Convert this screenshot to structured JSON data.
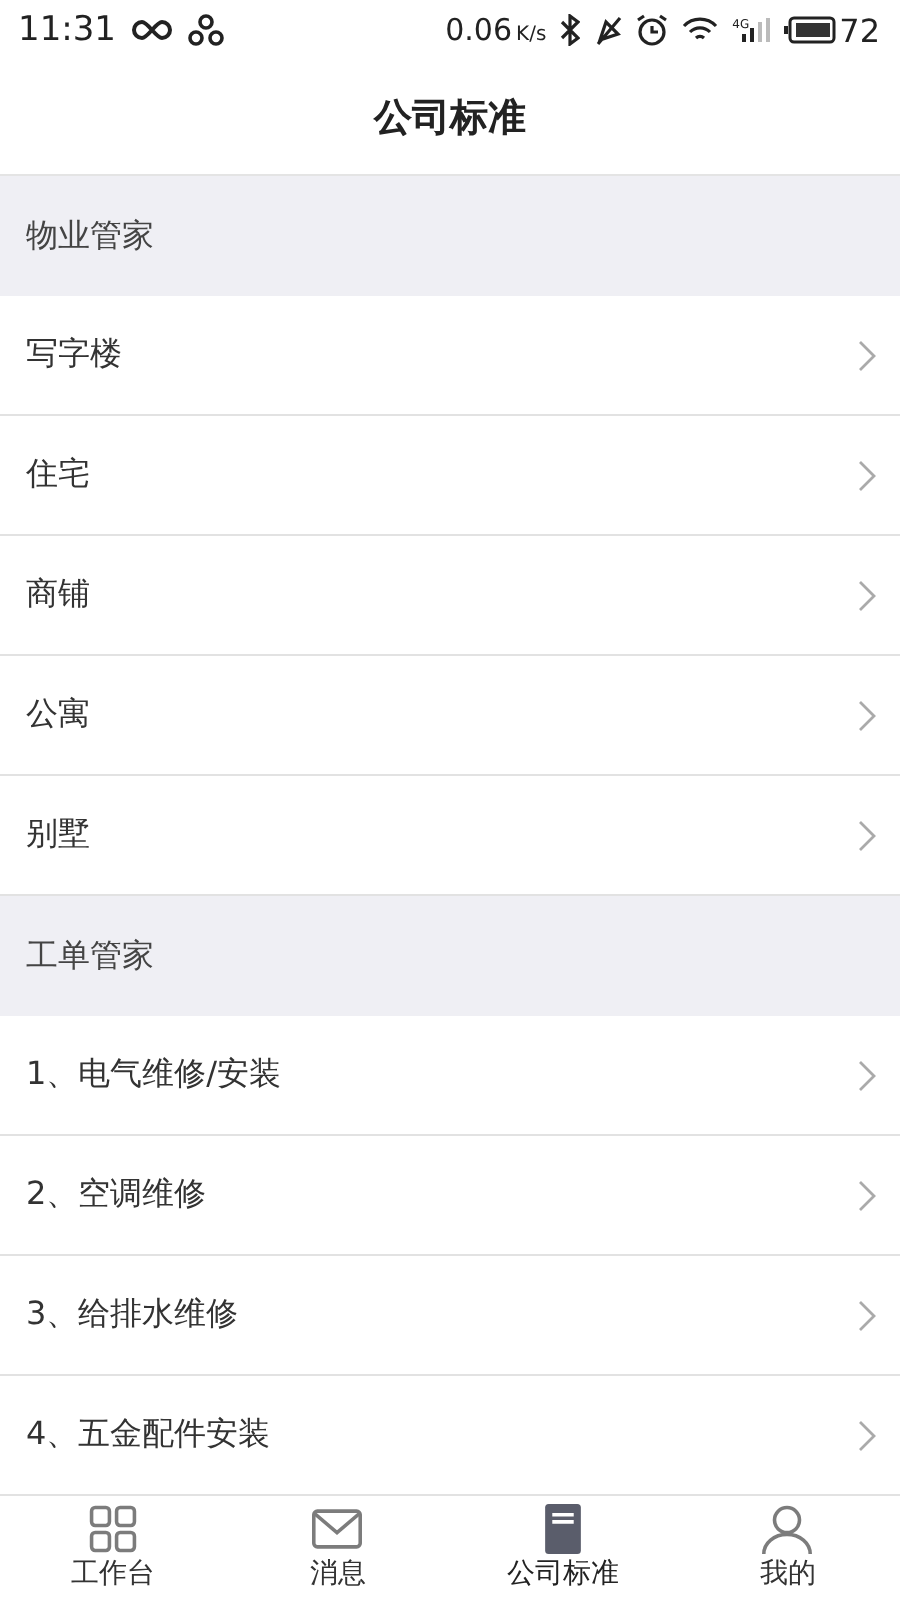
{
  "status_bar": {
    "time": "11:31",
    "speed": "0.06",
    "speed_unit": "K/s",
    "network": "4G",
    "battery": "72"
  },
  "header": {
    "title": "公司标准"
  },
  "sections": [
    {
      "title": "物业管家",
      "items": [
        {
          "label": "写字楼"
        },
        {
          "label": "住宅"
        },
        {
          "label": "商铺"
        },
        {
          "label": "公寓"
        },
        {
          "label": "别墅"
        }
      ]
    },
    {
      "title": "工单管家",
      "items": [
        {
          "label": "1、电气维修/安装"
        },
        {
          "label": "2、空调维修"
        },
        {
          "label": "3、给排水维修"
        },
        {
          "label": "4、五金配件安装"
        }
      ]
    }
  ],
  "tab_bar": [
    {
      "label": "工作台",
      "kind": "grid",
      "selected": false
    },
    {
      "label": "消息",
      "kind": "mail",
      "selected": false
    },
    {
      "label": "公司标准",
      "kind": "book",
      "selected": true
    },
    {
      "label": "我的",
      "kind": "person",
      "selected": false
    }
  ]
}
